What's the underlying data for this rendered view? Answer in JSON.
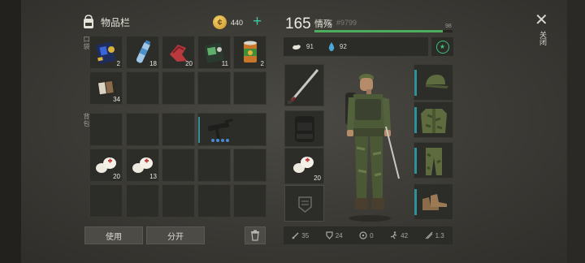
{
  "header": {
    "title": "物品栏",
    "coins": "440",
    "level": "165",
    "player_name": "情殇",
    "player_id": "#9799",
    "xp_value": "98",
    "xp_fraction": 0.93,
    "food": "91",
    "water": "92"
  },
  "side_labels": {
    "pocket": "口袋",
    "backpack": "背包"
  },
  "inventory": {
    "counts": {
      "item_radio": "2",
      "item_bottle": "18",
      "item_red_cloth": "20",
      "item_green_device": "11",
      "item_can": "2",
      "item_book": "34",
      "item_bandage_a": "20",
      "item_bandage_b": "13"
    }
  },
  "buttons": {
    "use": "使用",
    "split": "分开"
  },
  "equipment": {
    "bandage_count": "20"
  },
  "stats": {
    "attack": "35",
    "defense": "24",
    "radiation": "0",
    "speed": "42",
    "crit": "1.3"
  },
  "close_label": "关闭",
  "colors": {
    "accent": "#3fc7a2",
    "xp_bar": "#4cae5a",
    "slot_accent": "#2f8f9a"
  }
}
